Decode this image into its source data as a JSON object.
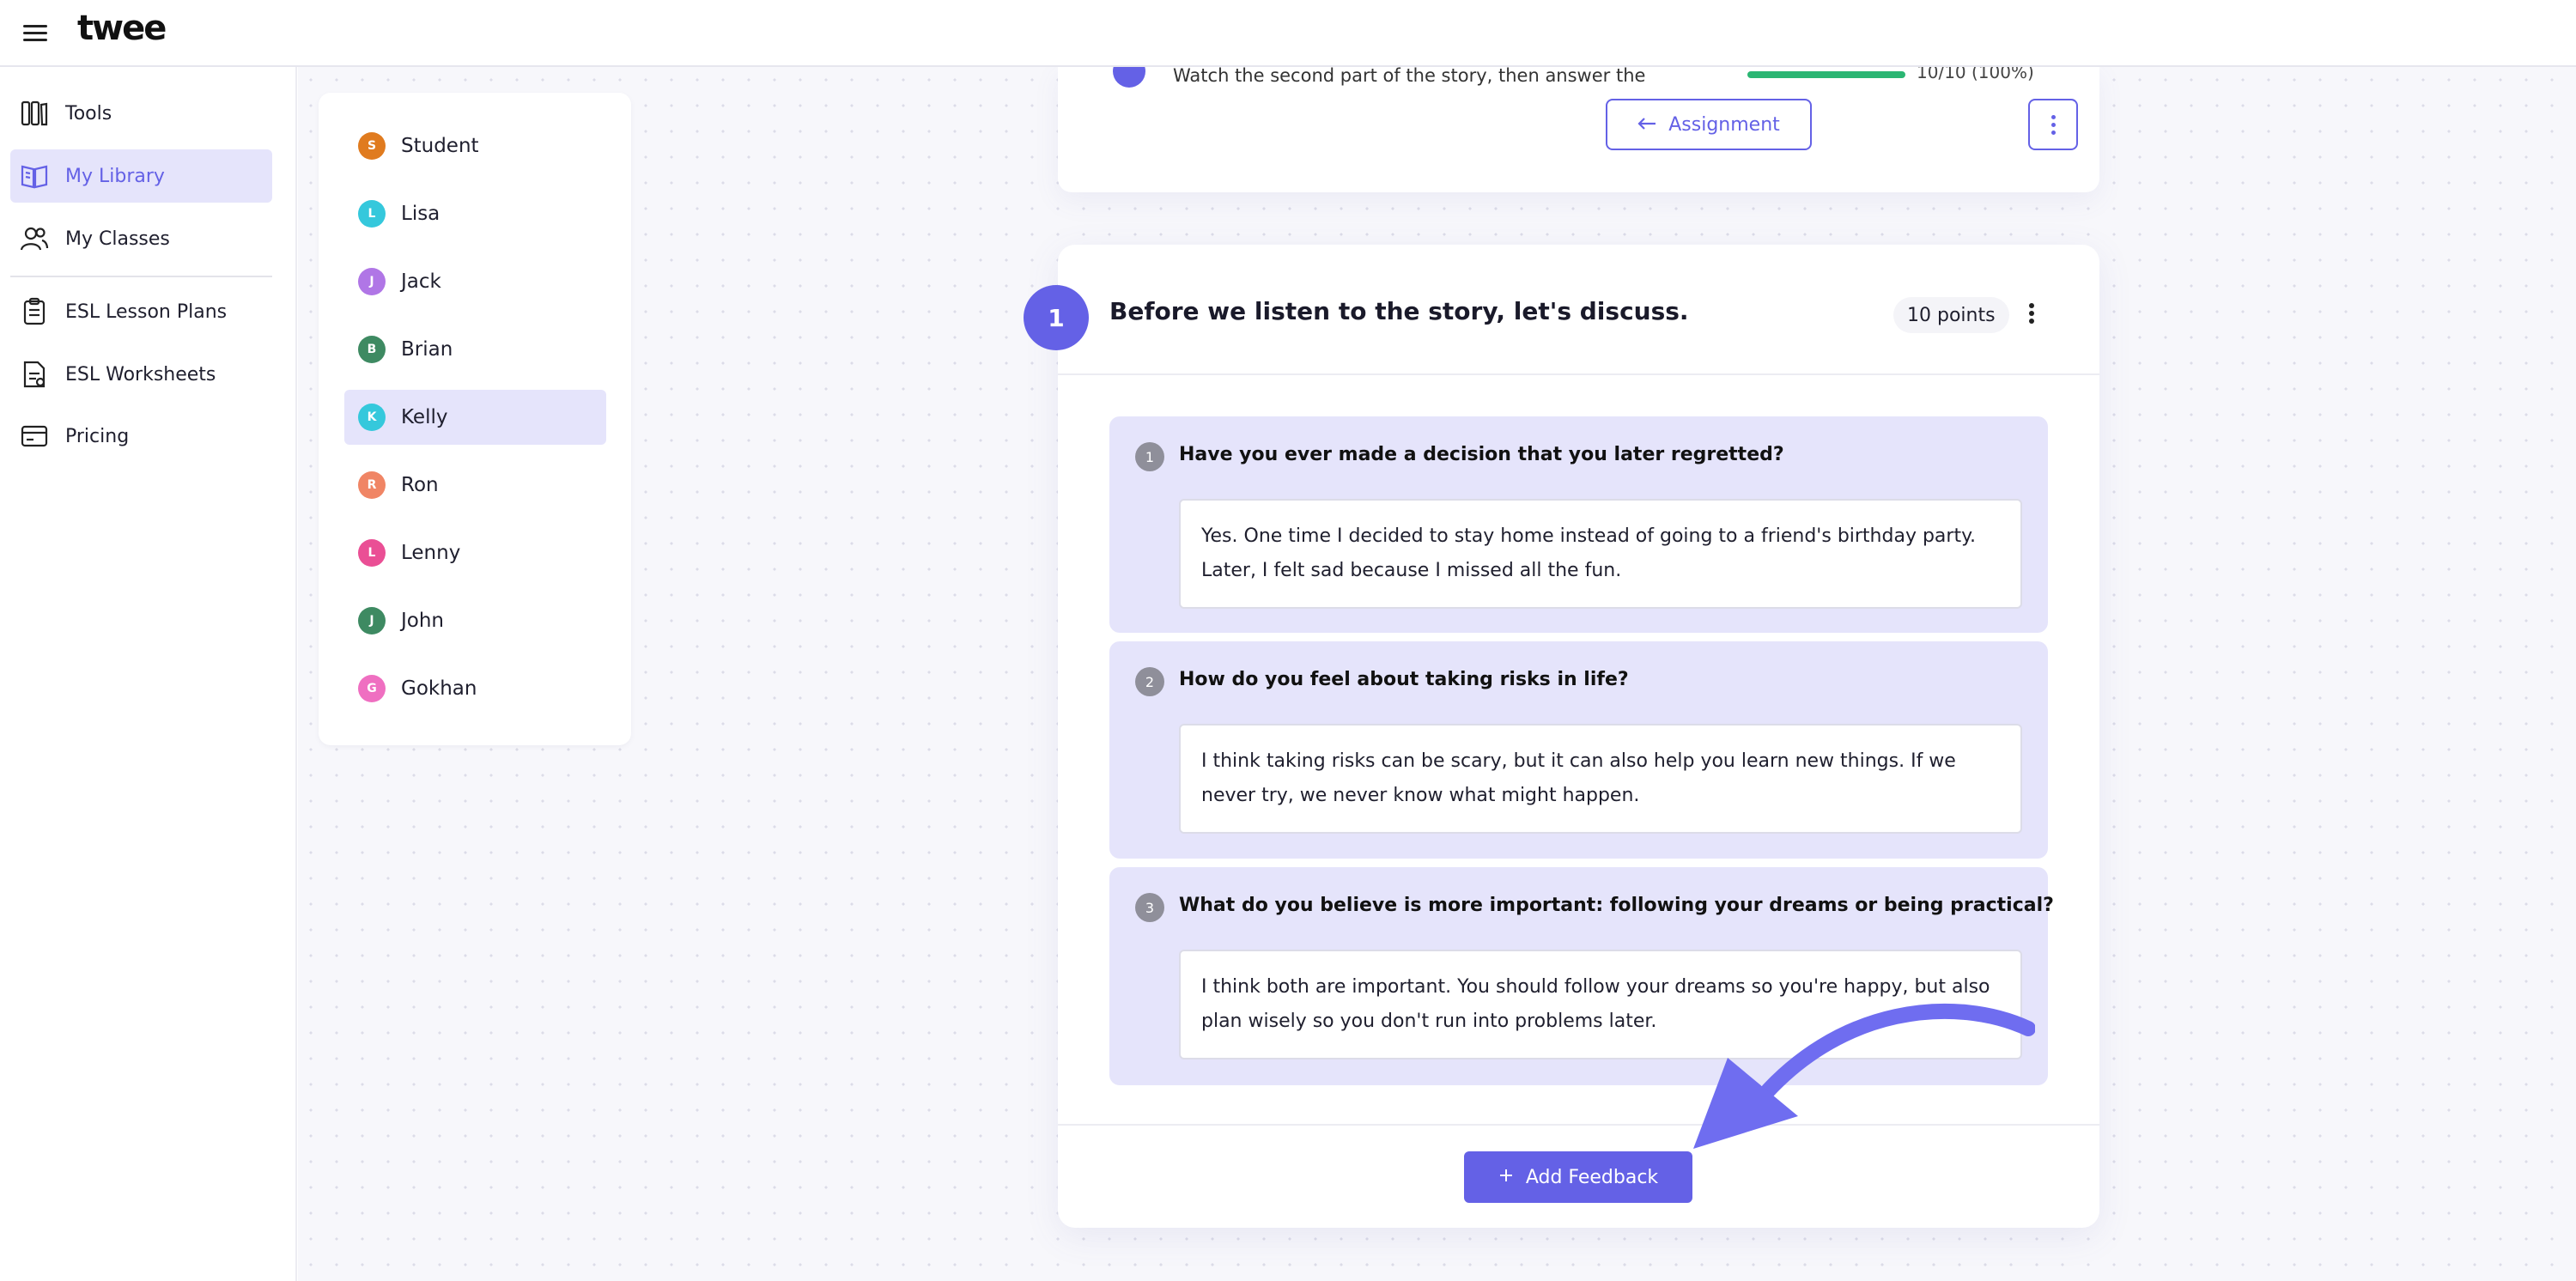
{
  "app": {
    "logo": "twee"
  },
  "sidebar": {
    "items": [
      {
        "label": "Tools",
        "icon": "tools-icon"
      },
      {
        "label": "My Library",
        "icon": "library-book-icon",
        "active": true
      },
      {
        "label": "My Classes",
        "icon": "users-icon"
      },
      {
        "label": "ESL Lesson Plans",
        "icon": "clipboard-icon"
      },
      {
        "label": "ESL Worksheets",
        "icon": "worksheet-icon"
      },
      {
        "label": "Pricing",
        "icon": "card-icon"
      }
    ]
  },
  "students": {
    "list": [
      {
        "initial": "S",
        "name": "Student",
        "color": "#e07b1f"
      },
      {
        "initial": "L",
        "name": "Lisa",
        "color": "#35c8dc"
      },
      {
        "initial": "J",
        "name": "Jack",
        "color": "#b076e6"
      },
      {
        "initial": "B",
        "name": "Brian",
        "color": "#3e8a62"
      },
      {
        "initial": "K",
        "name": "Kelly",
        "color": "#35c8dc",
        "active": true
      },
      {
        "initial": "R",
        "name": "Ron",
        "color": "#f08565"
      },
      {
        "initial": "L",
        "name": "Lenny",
        "color": "#ea4f95"
      },
      {
        "initial": "J",
        "name": "John",
        "color": "#3e8a62"
      },
      {
        "initial": "G",
        "name": "Gokhan",
        "color": "#ef6fc1"
      }
    ]
  },
  "topcard": {
    "partial_text": "Watch the second part of the story, then answer the",
    "score": "10/10     (100%)",
    "assignment_button": "Assignment"
  },
  "question": {
    "number": "1",
    "title": "Before we listen to the story, let's discuss.",
    "points": "10 points",
    "subquestions": [
      {
        "num": "1",
        "text": "Have you ever made a decision that you later regretted?",
        "answer": "Yes. One time I decided to stay home instead of going to a friend's birthday party. Later, I felt sad because I missed all the fun."
      },
      {
        "num": "2",
        "text": "How do you feel about taking risks in life?",
        "answer": "I think taking risks can be scary, but it can also help you learn new things. If we never try, we never know what might happen."
      },
      {
        "num": "3",
        "text": "What do you believe is more important: following your dreams or being practical?",
        "answer": "I think both are important. You should follow your dreams so you're happy, but also plan wisely so you don't run into problems later."
      }
    ],
    "feedback_button": "Add Feedback"
  },
  "colors": {
    "accent": "#6461e6",
    "accent_light": "#e5e4fb",
    "progress": "#2bb673"
  }
}
